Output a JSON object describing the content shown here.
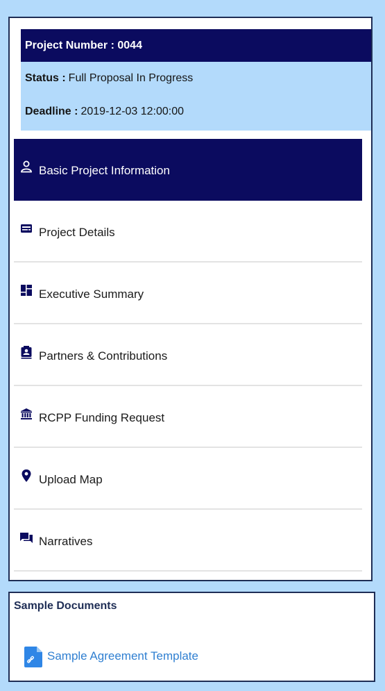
{
  "project": {
    "number_label": "Project Number :",
    "number_value": "0044",
    "status_label": "Status :",
    "status_value": "Full Proposal In Progress",
    "deadline_label": "Deadline :",
    "deadline_value": "2019-12-03 12:00:00"
  },
  "nav": {
    "items": [
      {
        "label": "Basic Project Information",
        "icon": "person-icon",
        "active": true
      },
      {
        "label": "Project Details",
        "icon": "card-icon"
      },
      {
        "label": "Executive Summary",
        "icon": "dashboard-icon"
      },
      {
        "label": "Partners & Contributions",
        "icon": "contact-card-icon"
      },
      {
        "label": "RCPP Funding Request",
        "icon": "bank-icon"
      },
      {
        "label": "Upload Map",
        "icon": "location-pin-icon"
      },
      {
        "label": "Narratives",
        "icon": "chat-icon"
      }
    ]
  },
  "documents": {
    "title": "Sample Documents",
    "items": [
      {
        "label": "Sample Agreement Template",
        "icon": "file-link-icon"
      }
    ]
  },
  "colors": {
    "navy": "#0b0b5f",
    "light_blue": "#b3dafb",
    "link": "#2f7fd1"
  }
}
